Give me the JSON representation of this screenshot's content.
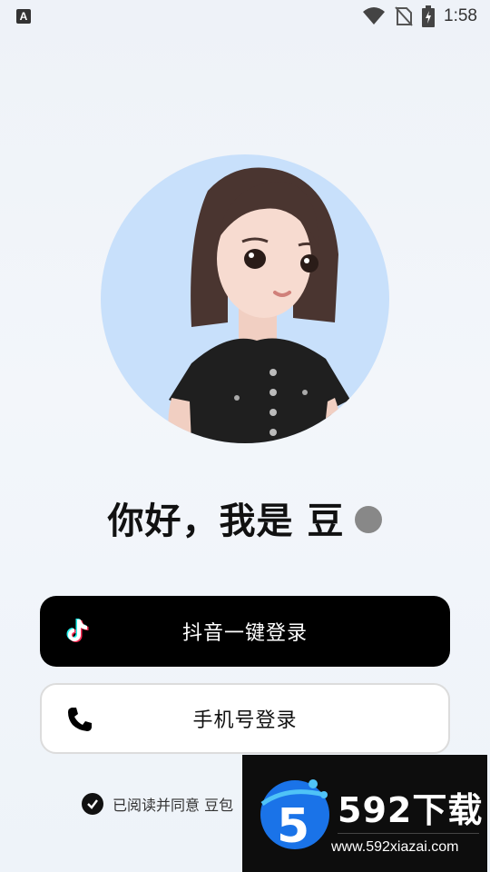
{
  "status_bar": {
    "left_icon": "A",
    "time": "1:58",
    "icons": [
      "wifi-icon",
      "no-sim-icon",
      "battery-charging-icon"
    ]
  },
  "avatar": {
    "icon": "cartoon-girl-avatar"
  },
  "greeting": {
    "text": "你好，我是 豆"
  },
  "buttons": {
    "douyin_login": "抖音一键登录",
    "phone_login": "手机号登录"
  },
  "agreement": {
    "text": "已阅读并同意 豆包"
  },
  "watermark": {
    "brand": "592下载",
    "url": "www.592xiazai.com"
  },
  "colors": {
    "primary": "#000000",
    "avatar_bg": "#c8e0fb",
    "secondary_bg": "#ffffff"
  }
}
